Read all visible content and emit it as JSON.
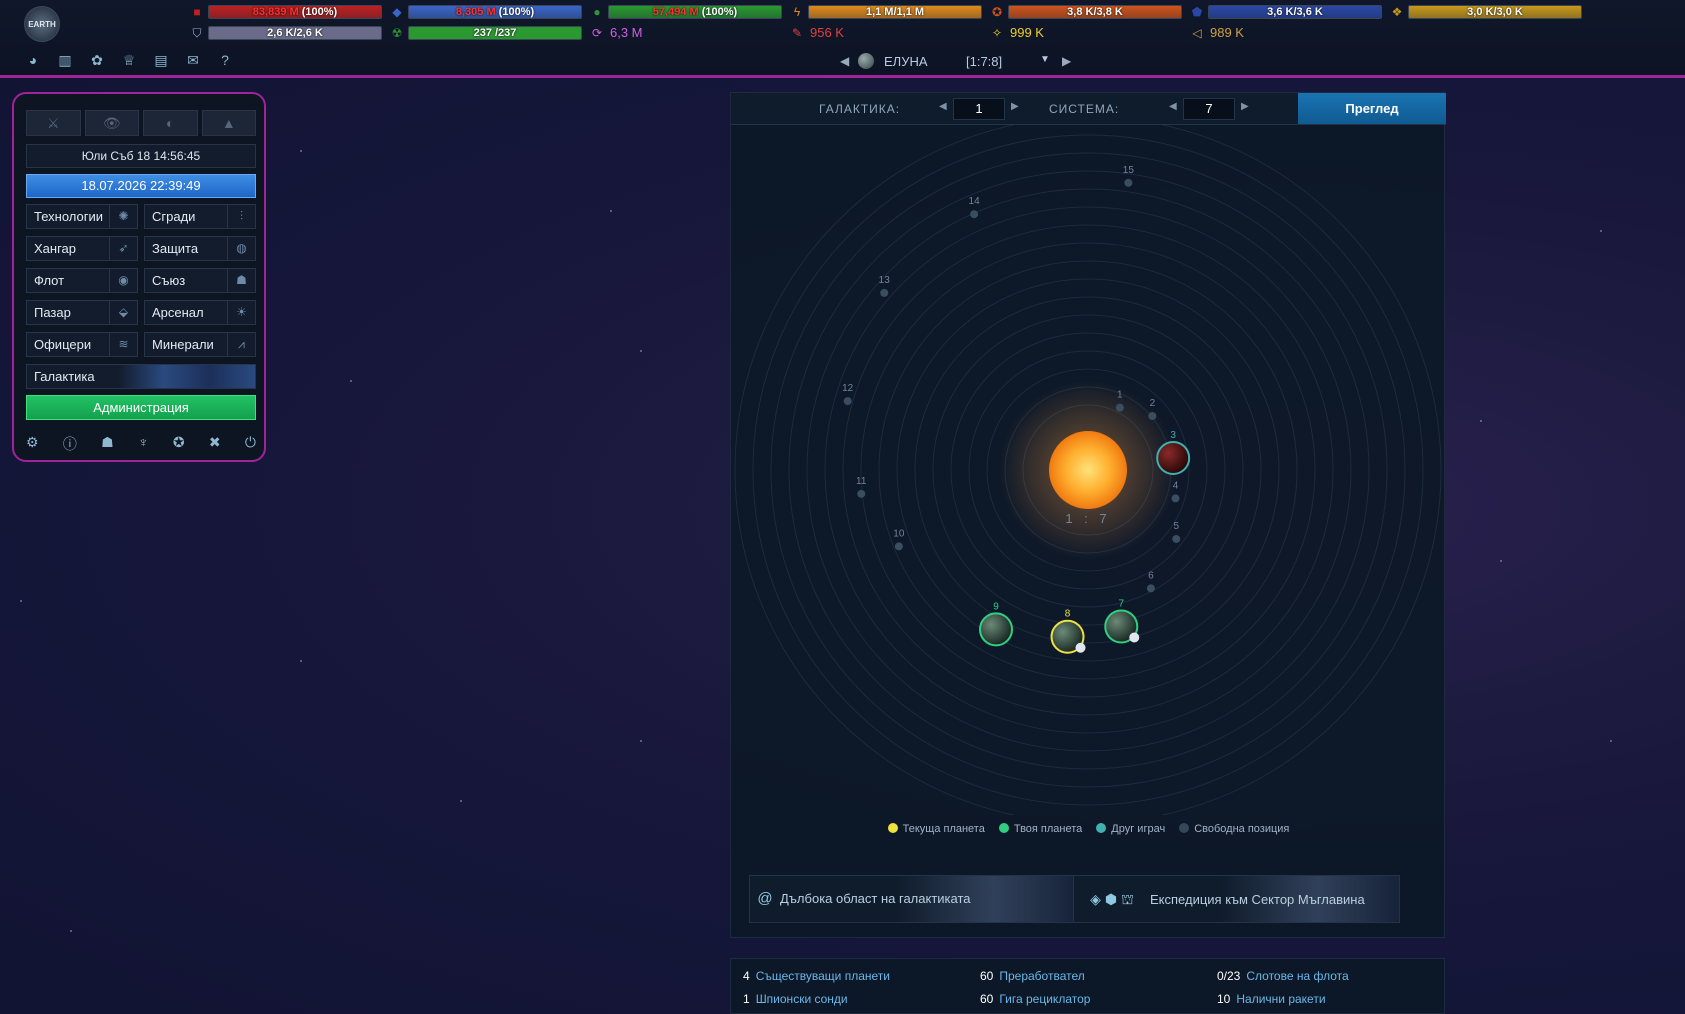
{
  "topbar": {
    "logo": "EARTH",
    "row1": [
      {
        "icon": "metal-icon",
        "text": "83,839 M",
        "pct": "(100%)",
        "color": "#c02020",
        "fill": 1.0
      },
      {
        "icon": "crystal-icon",
        "text": "8,305 M",
        "pct": "(100%)",
        "color": "#3a66c8",
        "fill": 1.0
      },
      {
        "icon": "deuterium-icon",
        "text": "57,494 M",
        "pct": "(100%)",
        "color": "#2a9a30",
        "fill": 1.0
      },
      {
        "icon": "energy-icon",
        "text": "1,1 M/1,1 M",
        "color": "#e08a1a",
        "fill": 1.0
      },
      {
        "icon": "orange-resource-icon",
        "text": "3,8 K/3,8 K",
        "color": "#d0541a",
        "fill": 1.0
      },
      {
        "icon": "blue-resource-icon",
        "text": "3,6 K/3,6 K",
        "color": "#2a48a8",
        "fill": 1.0
      },
      {
        "icon": "gold-resource-icon",
        "text": "3,0 K/3,0 K",
        "color": "#c89a1a",
        "fill": 1.0
      }
    ],
    "row2": [
      {
        "icon": "shield-icon",
        "text": "2,6 K/2,6 K",
        "type": "bar",
        "color": "#6a6a8a",
        "fill": 1.0
      },
      {
        "icon": "radiation-icon",
        "text": "237 /237",
        "type": "bar",
        "color": "#2a9a30",
        "fill": 1.0
      },
      {
        "icon": "cycle-icon",
        "text": "6,3 M",
        "type": "value",
        "color": "#d060e0"
      },
      {
        "icon": "tool-icon",
        "text": "956 K",
        "type": "value",
        "color": "#e04040"
      },
      {
        "icon": "star-icon",
        "text": "999 K",
        "type": "value",
        "color": "#f0d020"
      },
      {
        "icon": "box-icon",
        "text": "989 K",
        "type": "value",
        "color": "#d0a040"
      }
    ],
    "icons": [
      "planet-icon",
      "stats-icon",
      "medal-icon",
      "trophy-icon",
      "chat-icon",
      "mail-icon",
      "help-icon"
    ],
    "help_label": "?",
    "planet_name": "ЕЛУНА",
    "planet_coords": "[1:7:8]"
  },
  "leftpanel": {
    "server_time": "Юли Съб 18 14:56:45",
    "clock": "18.07.2026 22:39:49",
    "menu": [
      {
        "label": "Технологии",
        "icon": "atom-icon"
      },
      {
        "label": "Сгради",
        "icon": "sliders-icon"
      },
      {
        "label": "Хангар",
        "icon": "rocket-icon"
      },
      {
        "label": "Защита",
        "icon": "defense-icon"
      },
      {
        "label": "Флот",
        "icon": "fleet-icon"
      },
      {
        "label": "Съюз",
        "icon": "alliance-icon"
      },
      {
        "label": "Пазар",
        "icon": "tag-icon"
      },
      {
        "label": "Арсенал",
        "icon": "sun-icon"
      },
      {
        "label": "Офицери",
        "icon": "rank-icon"
      },
      {
        "label": "Минерали",
        "icon": "graph-icon"
      }
    ],
    "galaxy": "Галактика",
    "admin": "Администрация"
  },
  "galaxy": {
    "label_galaxy": "ГАЛАКТИКА:",
    "galaxy_value": "1",
    "label_system": "СИСТЕМА:",
    "system_value": "7",
    "review": "Преглед",
    "sun_label": "1 : 7",
    "positions": [
      {
        "n": "1",
        "status": "free"
      },
      {
        "n": "2",
        "status": "free"
      },
      {
        "n": "3",
        "status": "other"
      },
      {
        "n": "4",
        "status": "free"
      },
      {
        "n": "5",
        "status": "free"
      },
      {
        "n": "6",
        "status": "free"
      },
      {
        "n": "7",
        "status": "own"
      },
      {
        "n": "8",
        "status": "current"
      },
      {
        "n": "9",
        "status": "own"
      },
      {
        "n": "10",
        "status": "free"
      },
      {
        "n": "11",
        "status": "free"
      },
      {
        "n": "12",
        "status": "free"
      },
      {
        "n": "13",
        "status": "free"
      },
      {
        "n": "14",
        "status": "free"
      },
      {
        "n": "15",
        "status": "free"
      }
    ],
    "legend": [
      {
        "label": "Текуща планета",
        "color": "#f0e040"
      },
      {
        "label": "Твоя планета",
        "color": "#30d080"
      },
      {
        "label": "Друг играч",
        "color": "#40b0b0"
      },
      {
        "label": "Свободна позиция",
        "color": "#34485a"
      }
    ],
    "deep_space": "Дълбока област на галактиката",
    "expedition": "Експедиция към Сектор Мъглавина"
  },
  "stats": [
    {
      "num": "4",
      "label": "Съществуващи планети"
    },
    {
      "num": "60",
      "label": "Преработвател"
    },
    {
      "num": "0/23",
      "label": "Слотове на флота"
    },
    {
      "num": "1",
      "label": "Шпионски сонди"
    },
    {
      "num": "60",
      "label": "Гига рециклатор"
    },
    {
      "num": "10",
      "label": "Налични ракети"
    }
  ]
}
